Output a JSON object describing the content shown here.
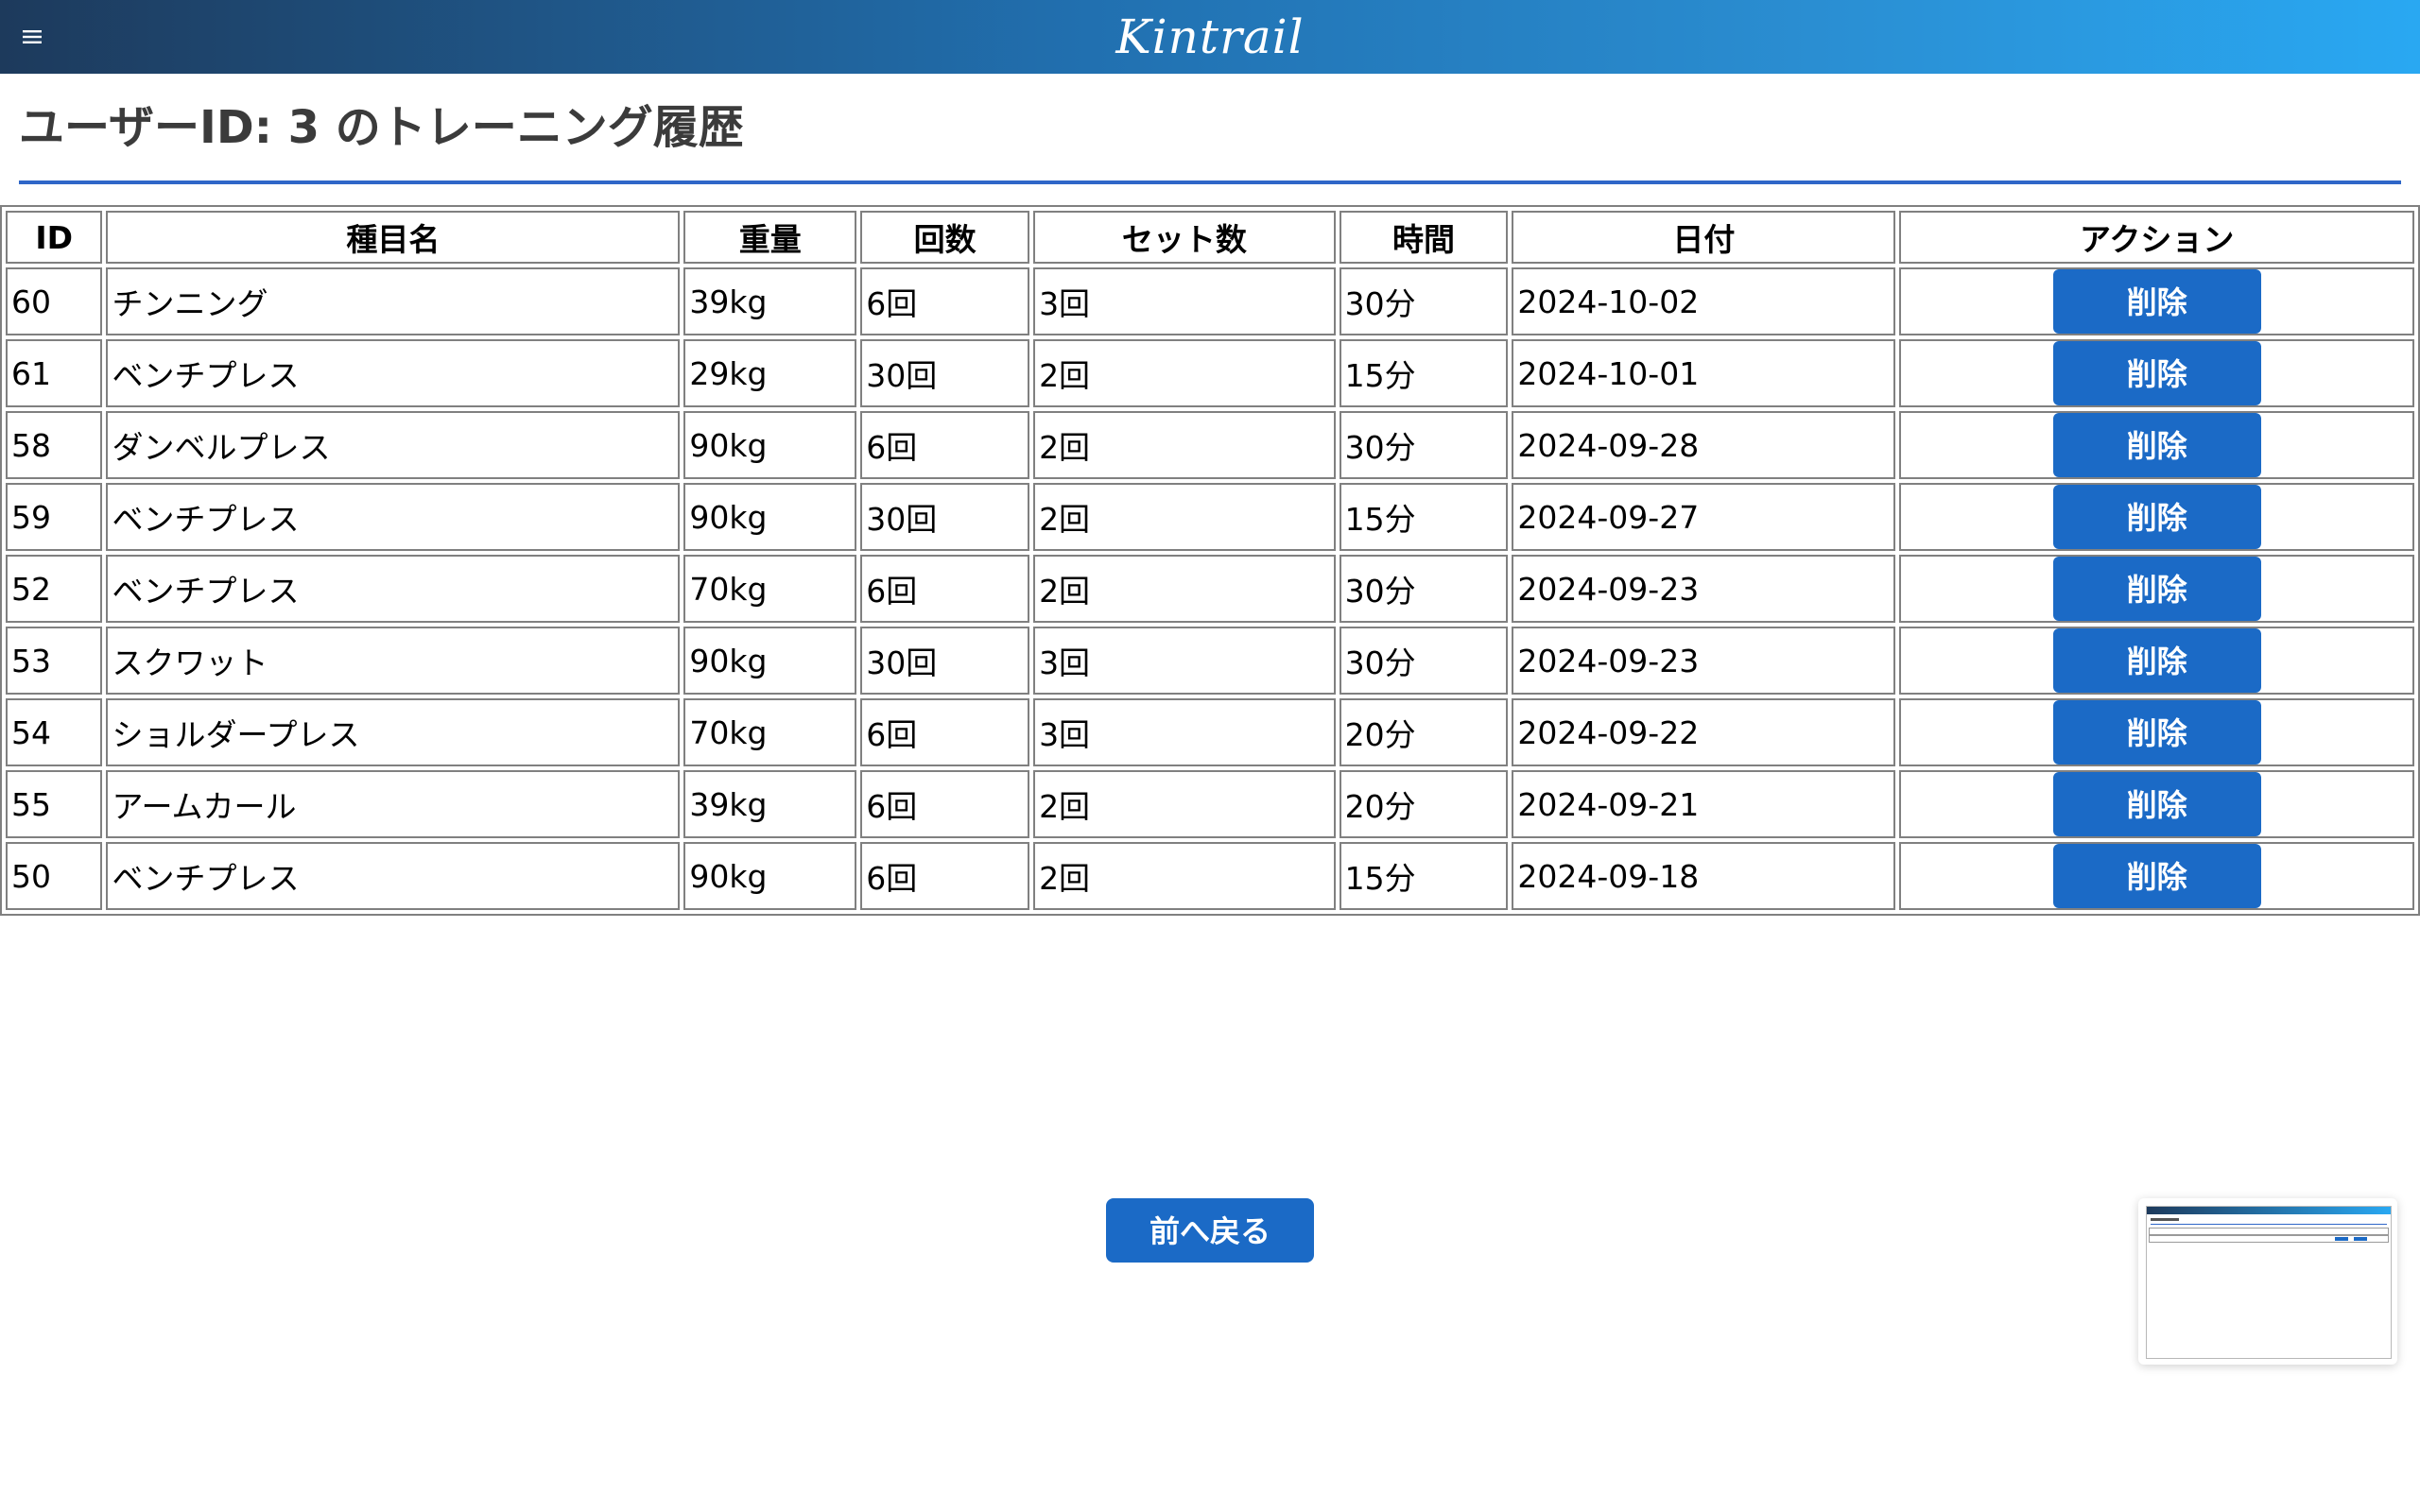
{
  "app": {
    "brand": "Kintrail"
  },
  "page": {
    "title": "ユーザーID: 3 のトレーニング履歴"
  },
  "table": {
    "columns": [
      "ID",
      "種目名",
      "重量",
      "回数",
      "セット数",
      "時間",
      "日付",
      "アクション"
    ],
    "delete_label": "削除",
    "rows": [
      {
        "id": "60",
        "exercise": "チンニング",
        "weight": "39kg",
        "reps": "6回",
        "sets": "3回",
        "time": "30分",
        "date": "2024-10-02"
      },
      {
        "id": "61",
        "exercise": "ベンチプレス",
        "weight": "29kg",
        "reps": "30回",
        "sets": "2回",
        "time": "15分",
        "date": "2024-10-01"
      },
      {
        "id": "58",
        "exercise": "ダンベルプレス",
        "weight": "90kg",
        "reps": "6回",
        "sets": "2回",
        "time": "30分",
        "date": "2024-09-28"
      },
      {
        "id": "59",
        "exercise": "ベンチプレス",
        "weight": "90kg",
        "reps": "30回",
        "sets": "2回",
        "time": "15分",
        "date": "2024-09-27"
      },
      {
        "id": "52",
        "exercise": "ベンチプレス",
        "weight": "70kg",
        "reps": "6回",
        "sets": "2回",
        "time": "30分",
        "date": "2024-09-23"
      },
      {
        "id": "53",
        "exercise": "スクワット",
        "weight": "90kg",
        "reps": "30回",
        "sets": "3回",
        "time": "30分",
        "date": "2024-09-23"
      },
      {
        "id": "54",
        "exercise": "ショルダープレス",
        "weight": "70kg",
        "reps": "6回",
        "sets": "3回",
        "time": "20分",
        "date": "2024-09-22"
      },
      {
        "id": "55",
        "exercise": "アームカール",
        "weight": "39kg",
        "reps": "6回",
        "sets": "2回",
        "time": "20分",
        "date": "2024-09-21"
      },
      {
        "id": "50",
        "exercise": "ベンチプレス",
        "weight": "90kg",
        "reps": "6回",
        "sets": "2回",
        "time": "15分",
        "date": "2024-09-18"
      }
    ]
  },
  "footer": {
    "back_label": "前へ戻る"
  },
  "icons": {
    "menu": "hamburger-menu-icon"
  },
  "colors": {
    "header_gradient_start": "#1d3a5c",
    "header_gradient_end": "#29a8f2",
    "button_bg": "#1b6ac6",
    "title_rule": "#2f66c8",
    "title_text": "#3b3b3b"
  }
}
